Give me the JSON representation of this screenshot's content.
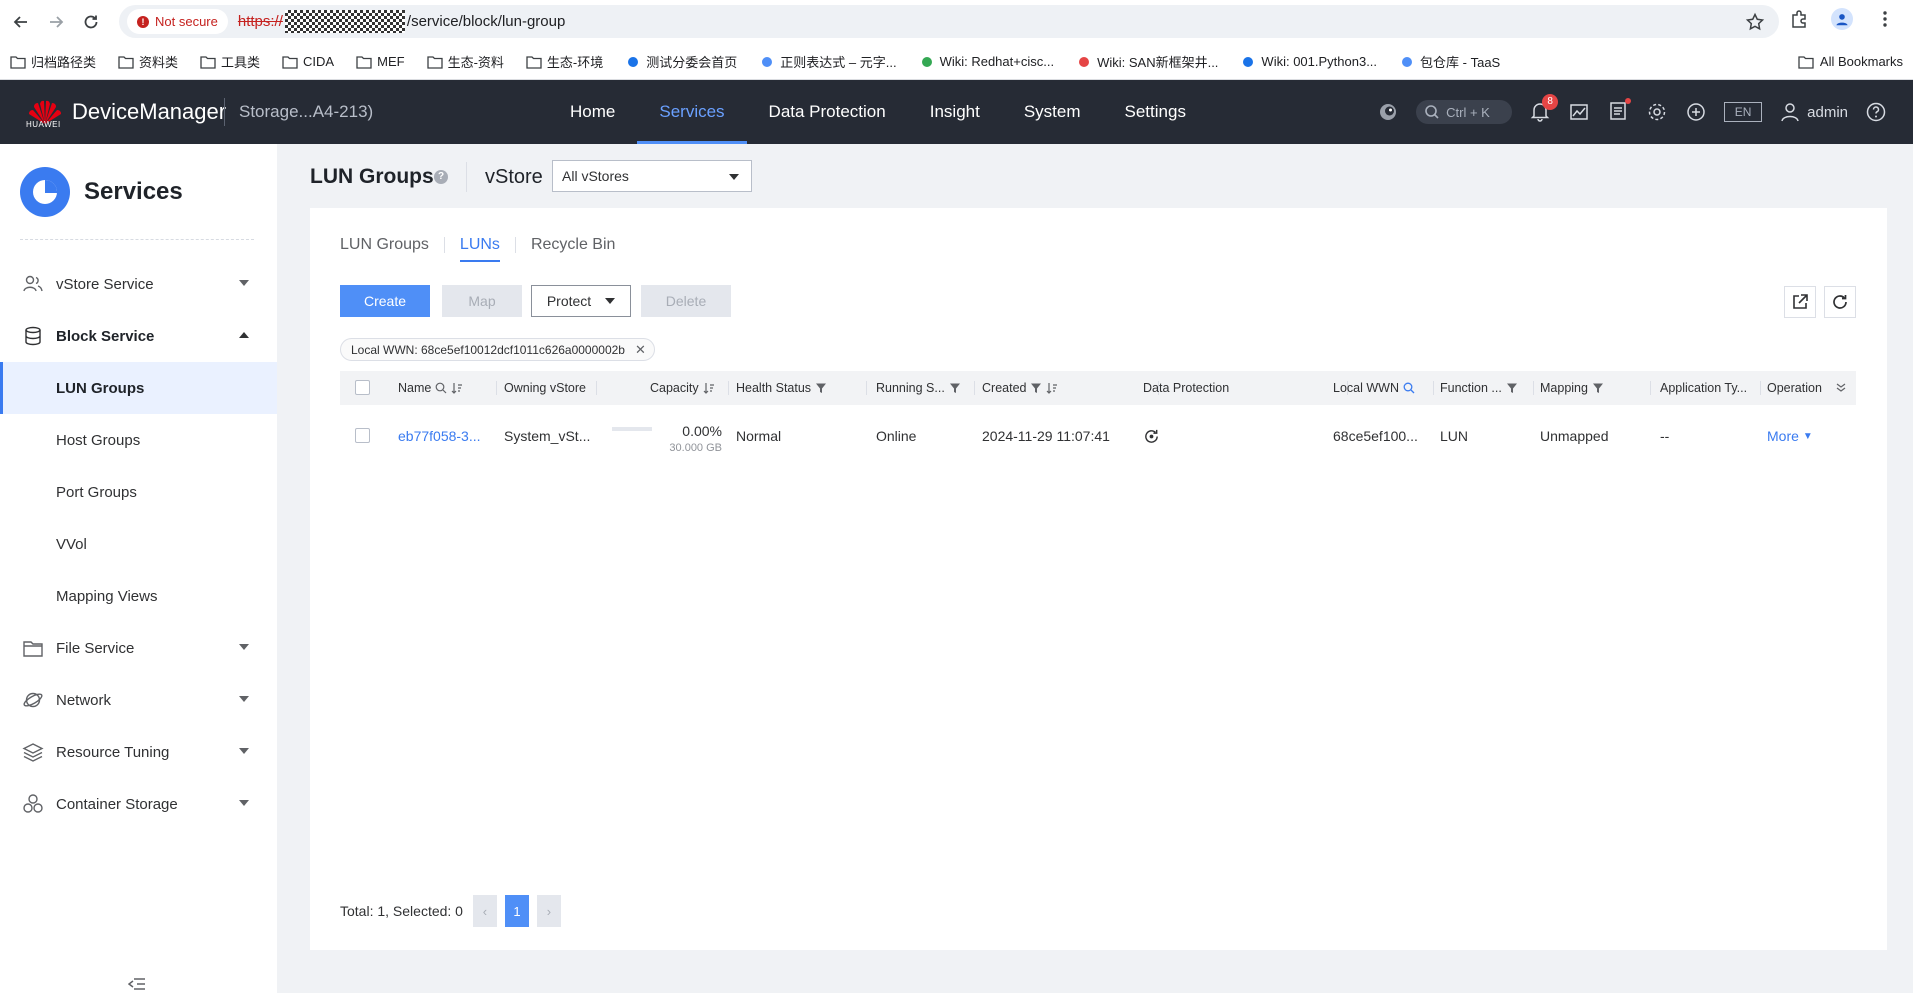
{
  "browser": {
    "security_label": "Not secure",
    "url_scheme": "https://",
    "url_path": "/service/block/lun-group",
    "bookmarks": [
      "归档路径类",
      "资料类",
      "工具类",
      "CIDA",
      "MEF",
      "生态-资料",
      "生态-环境",
      "测试分委会首页",
      "正则表达式 – 元字...",
      "Wiki: Redhat+cisc...",
      "Wiki: SAN新框架井...",
      "Wiki: 001.Python3...",
      "包仓库 - TaaS"
    ],
    "all_bookmarks": "All Bookmarks"
  },
  "header": {
    "brand": "HUAWEI",
    "product": "DeviceManager",
    "device": "Storage...A4-213)",
    "nav": [
      "Home",
      "Services",
      "Data Protection",
      "Insight",
      "System",
      "Settings"
    ],
    "active_nav": "Services",
    "search_hint": "Ctrl + K",
    "alarm_count": "8",
    "language": "EN",
    "user": "admin"
  },
  "sidebar": {
    "title": "Services",
    "items": {
      "vstore": "vStore Service",
      "block": "Block Service",
      "file": "File Service",
      "network": "Network",
      "tuning": "Resource Tuning",
      "container": "Container Storage"
    },
    "block_children": [
      "LUN Groups",
      "Host Groups",
      "Port Groups",
      "VVol",
      "Mapping Views"
    ],
    "active_child": "LUN Groups"
  },
  "page": {
    "title": "LUN Groups",
    "vstore_label": "vStore",
    "vstore_value": "All vStores",
    "tabs": [
      "LUN Groups",
      "LUNs",
      "Recycle Bin"
    ],
    "active_tab": "LUNs",
    "toolbar": {
      "create": "Create",
      "map": "Map",
      "protect": "Protect",
      "delete": "Delete"
    },
    "filter_chip": "Local WWN: 68ce5ef10012dcf1011c626a0000002b",
    "columns": {
      "name": "Name",
      "owning_vstore": "Owning vStore",
      "capacity": "Capacity",
      "health": "Health Status",
      "running": "Running S...",
      "created": "Created",
      "data_protection": "Data Protection",
      "local_wwn": "Local WWN",
      "function": "Function ...",
      "mapping": "Mapping",
      "app_type": "Application Ty...",
      "operation": "Operation"
    },
    "rows": [
      {
        "name": "eb77f058-3...",
        "owning_vstore": "System_vSt...",
        "capacity_pct": "0.00%",
        "capacity_fill": 0,
        "capacity_size": "30.000 GB",
        "health": "Normal",
        "running": "Online",
        "created": "2024-11-29 11:07:41",
        "local_wwn": "68ce5ef100...",
        "function": "LUN",
        "mapping": "Unmapped",
        "app_type": "--",
        "operation": "More"
      }
    ],
    "pagination": {
      "summary": "Total: 1, Selected: 0",
      "current_page": "1"
    }
  },
  "colors": {
    "accent": "#4f8ff7",
    "header_bg": "#262b35",
    "active_nav": "#6aa0ff"
  }
}
